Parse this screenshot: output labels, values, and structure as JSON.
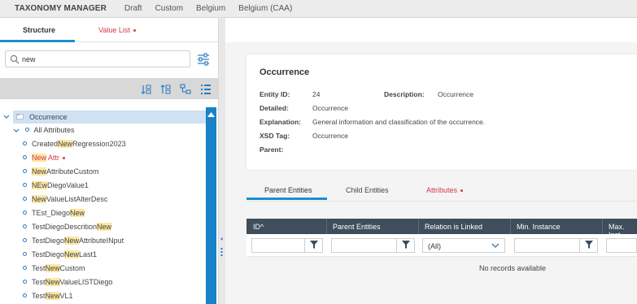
{
  "topbar": {
    "app_title": "TAXONOMY MANAGER",
    "crumbs": [
      "Draft",
      "Custom",
      "Belgium",
      "Belgium (CAA)"
    ]
  },
  "left_tabs": {
    "structure": "Structure",
    "value_list": "Value List"
  },
  "search": {
    "value": "new"
  },
  "tree": {
    "root": "Occurrence",
    "group": "All Attributes",
    "items": [
      {
        "pre": "Created",
        "hl": "New",
        "post": "Regression2023",
        "red": false
      },
      {
        "pre": "",
        "hl": "New",
        "post": " Attr",
        "red": true
      },
      {
        "pre": "",
        "hl": "New",
        "post": "AttributeCustom",
        "red": false
      },
      {
        "pre": "",
        "hl": "NEw",
        "post": "DiegoValue1",
        "red": false
      },
      {
        "pre": "",
        "hl": "New",
        "post": "ValueListAlterDesc",
        "red": false
      },
      {
        "pre": "TEst_Diego",
        "hl": "New",
        "post": "",
        "red": false
      },
      {
        "pre": "TestDiegoDescrition",
        "hl": "New",
        "post": "",
        "red": false
      },
      {
        "pre": "TestDiego",
        "hl": "New",
        "post": "AttributeINput",
        "red": false
      },
      {
        "pre": "TestDiego",
        "hl": "New",
        "post": "Last1",
        "red": false
      },
      {
        "pre": "Test",
        "hl": "New",
        "post": "Custom",
        "red": false
      },
      {
        "pre": "Test",
        "hl": "New",
        "post": "ValueLISTDiego",
        "red": false
      },
      {
        "pre": "Test",
        "hl": "New",
        "post": "VL1",
        "red": false
      }
    ]
  },
  "detail": {
    "title": "Occurrence",
    "entity_id_label": "Entity ID:",
    "entity_id": "24",
    "description_label": "Description:",
    "description": "Occurrence",
    "detailed_label": "Detailed:",
    "detailed": "Occurrence",
    "explanation_label": "Explanation:",
    "explanation": "General information and classification of the occurrence.",
    "xsd_label": "XSD Tag:",
    "xsd": "Occurrence",
    "parent_label": "Parent:",
    "parent": ""
  },
  "right_tabs": {
    "parent": "Parent Entities",
    "child": "Child Entities",
    "attributes": "Attributes"
  },
  "grid": {
    "headers": [
      "ID^",
      "Parent Entities",
      "Relation is Linked",
      "Min. Instance",
      "Max. Inst"
    ],
    "select_value": "(All)",
    "empty_text": "No records available"
  },
  "colors": {
    "accent": "#1a8fd0",
    "header_dark": "#3f4d5c",
    "highlight": "#fbe7a3",
    "alert_red": "#d1384a"
  }
}
